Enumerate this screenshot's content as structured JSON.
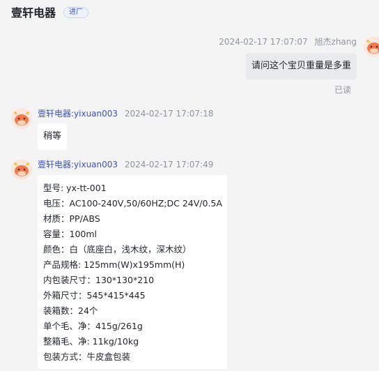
{
  "header": {
    "shop_name": "壹轩电器",
    "tag": "进厂"
  },
  "messages": [
    {
      "direction": "out",
      "timestamp": "2024-02-17 17:07:07",
      "sender": "旭杰zhang",
      "text": "请问这个宝贝重量是多重",
      "status": "已读"
    },
    {
      "direction": "in",
      "sender": "壹轩电器:yixuan003",
      "timestamp": "2024-02-17 17:07:18",
      "text": "稍等"
    },
    {
      "direction": "in",
      "sender": "壹轩电器:yixuan003",
      "timestamp": "2024-02-17 17:07:49",
      "lines": [
        "型号: yx-tt-001",
        "电压：AC100-240V,50/60HZ;DC 24V/0.5A",
        "材质：PP/ABS",
        "容量：100ml",
        "颜色：白（底座白，浅木纹，深木纹）",
        "产品规格: 125mm(W)x195mm(H)",
        "内包装尺寸：130*130*210",
        "外箱尺寸：545*415*445",
        "装箱数：24个",
        "单个毛、净：415g/261g",
        "整箱毛、净: 11kg/10kg",
        "包装方式：牛皮盒包装"
      ]
    }
  ],
  "colors": {
    "background": "#f4f4f5",
    "bubble_in": "#ffffff",
    "bubble_out": "#e9eaec",
    "sender_link": "#3b54b6",
    "meta_text": "#8f959e"
  }
}
